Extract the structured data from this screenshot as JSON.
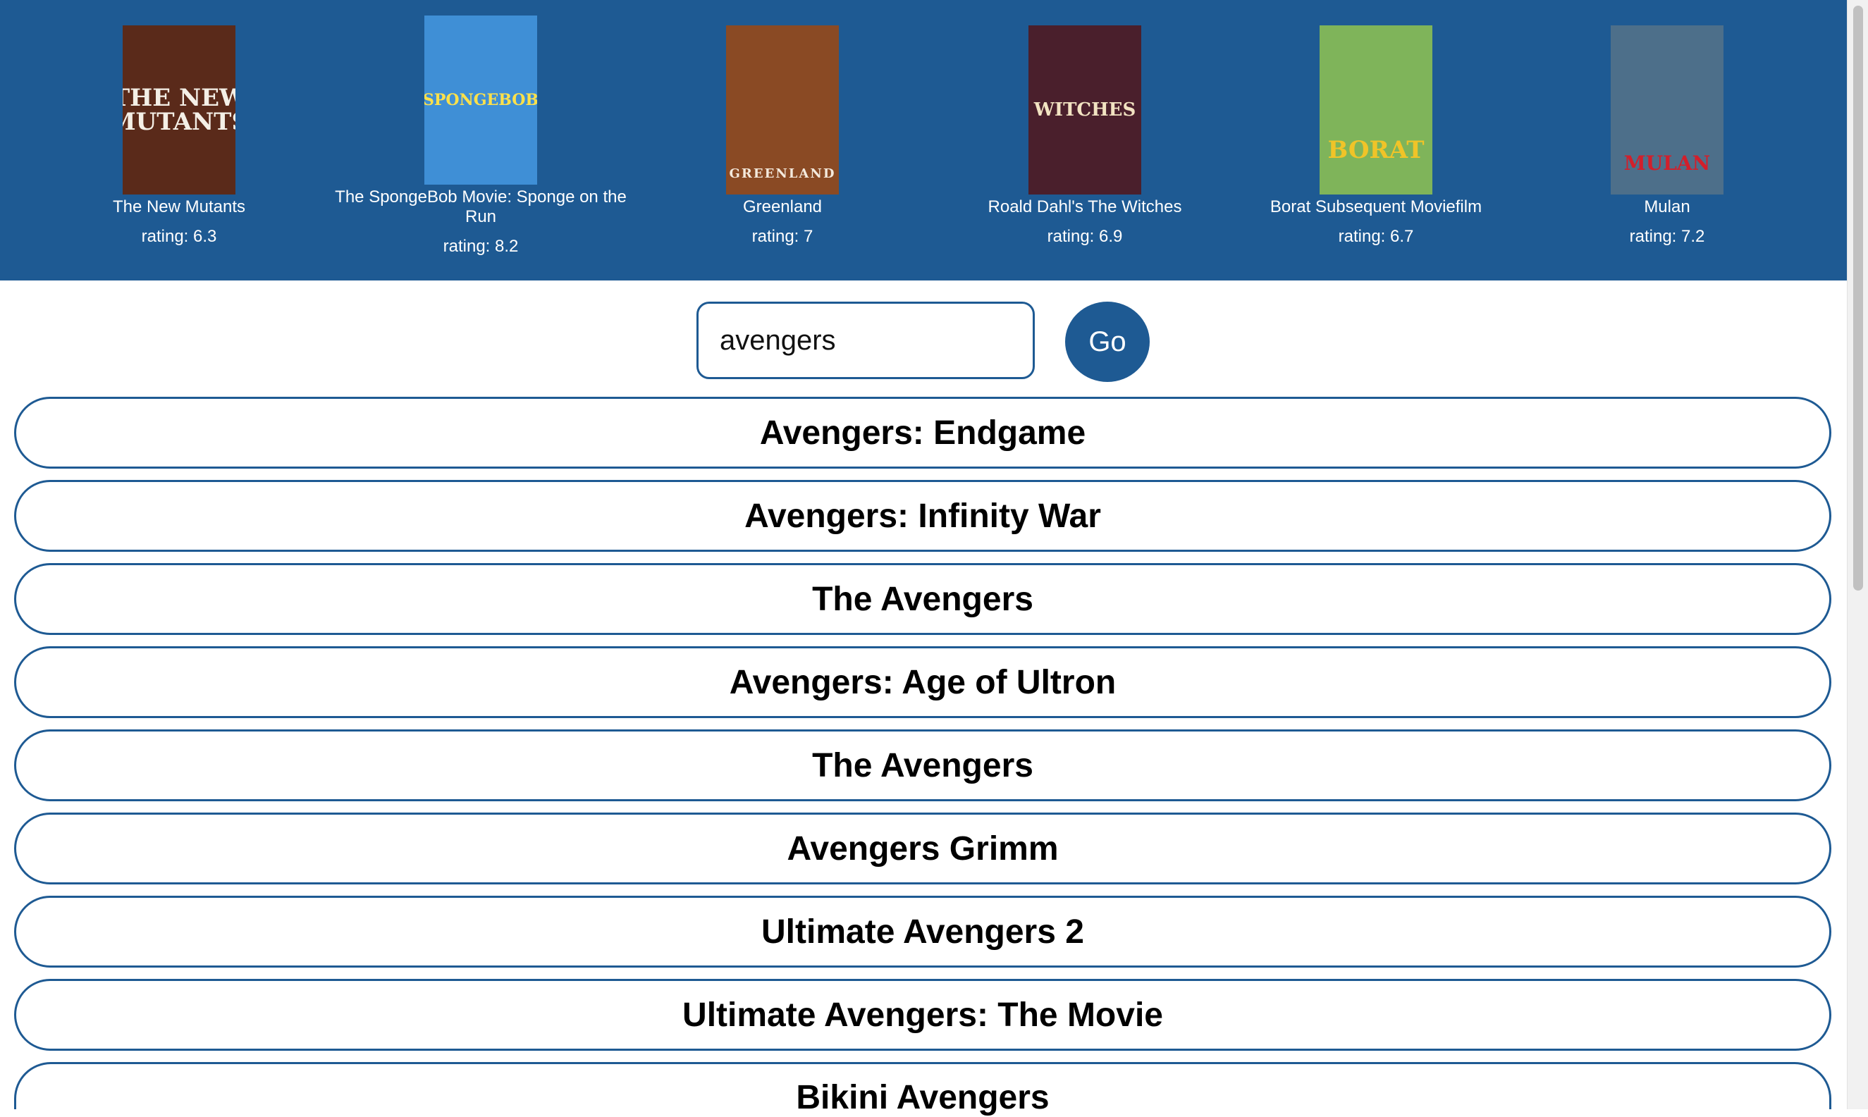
{
  "featured": [
    {
      "title": "The New Mutants",
      "rating": "rating: 6.3",
      "poster_text": "THE NEW MUTANTS",
      "poster_bg": "#5a2a1a",
      "poster_fg": "#f4efe6"
    },
    {
      "title": "The SpongeBob Movie: Sponge on the Run",
      "rating": "rating: 8.2",
      "poster_text": "SPONGEBOB",
      "poster_bg": "#3f8fd6",
      "poster_fg": "#ffe14a"
    },
    {
      "title": "Greenland",
      "rating": "rating: 7",
      "poster_text": "GREENLAND",
      "poster_bg": "#8a4a24",
      "poster_fg": "#f4e9dc"
    },
    {
      "title": "Roald Dahl's The Witches",
      "rating": "rating: 6.9",
      "poster_text": "WITCHES",
      "poster_bg": "#4a1f2c",
      "poster_fg": "#f2e3c2"
    },
    {
      "title": "Borat Subsequent Moviefilm",
      "rating": "rating: 6.7",
      "poster_text": "BORAT",
      "poster_bg": "#7fb45a",
      "poster_fg": "#f0c428"
    },
    {
      "title": "Mulan",
      "rating": "rating: 7.2",
      "poster_text": "MULAN",
      "poster_bg": "#4d6f8a",
      "poster_fg": "#d21f2b"
    }
  ],
  "search": {
    "value": "avengers",
    "button_label": "Go"
  },
  "results": [
    "Avengers: Endgame",
    "Avengers: Infinity War",
    "The Avengers",
    "Avengers: Age of Ultron",
    "The Avengers",
    "Avengers Grimm",
    "Ultimate Avengers 2",
    "Ultimate Avengers: The Movie",
    "Bikini Avengers"
  ],
  "colors": {
    "accent": "#1e5a93",
    "background": "#ffffff"
  }
}
